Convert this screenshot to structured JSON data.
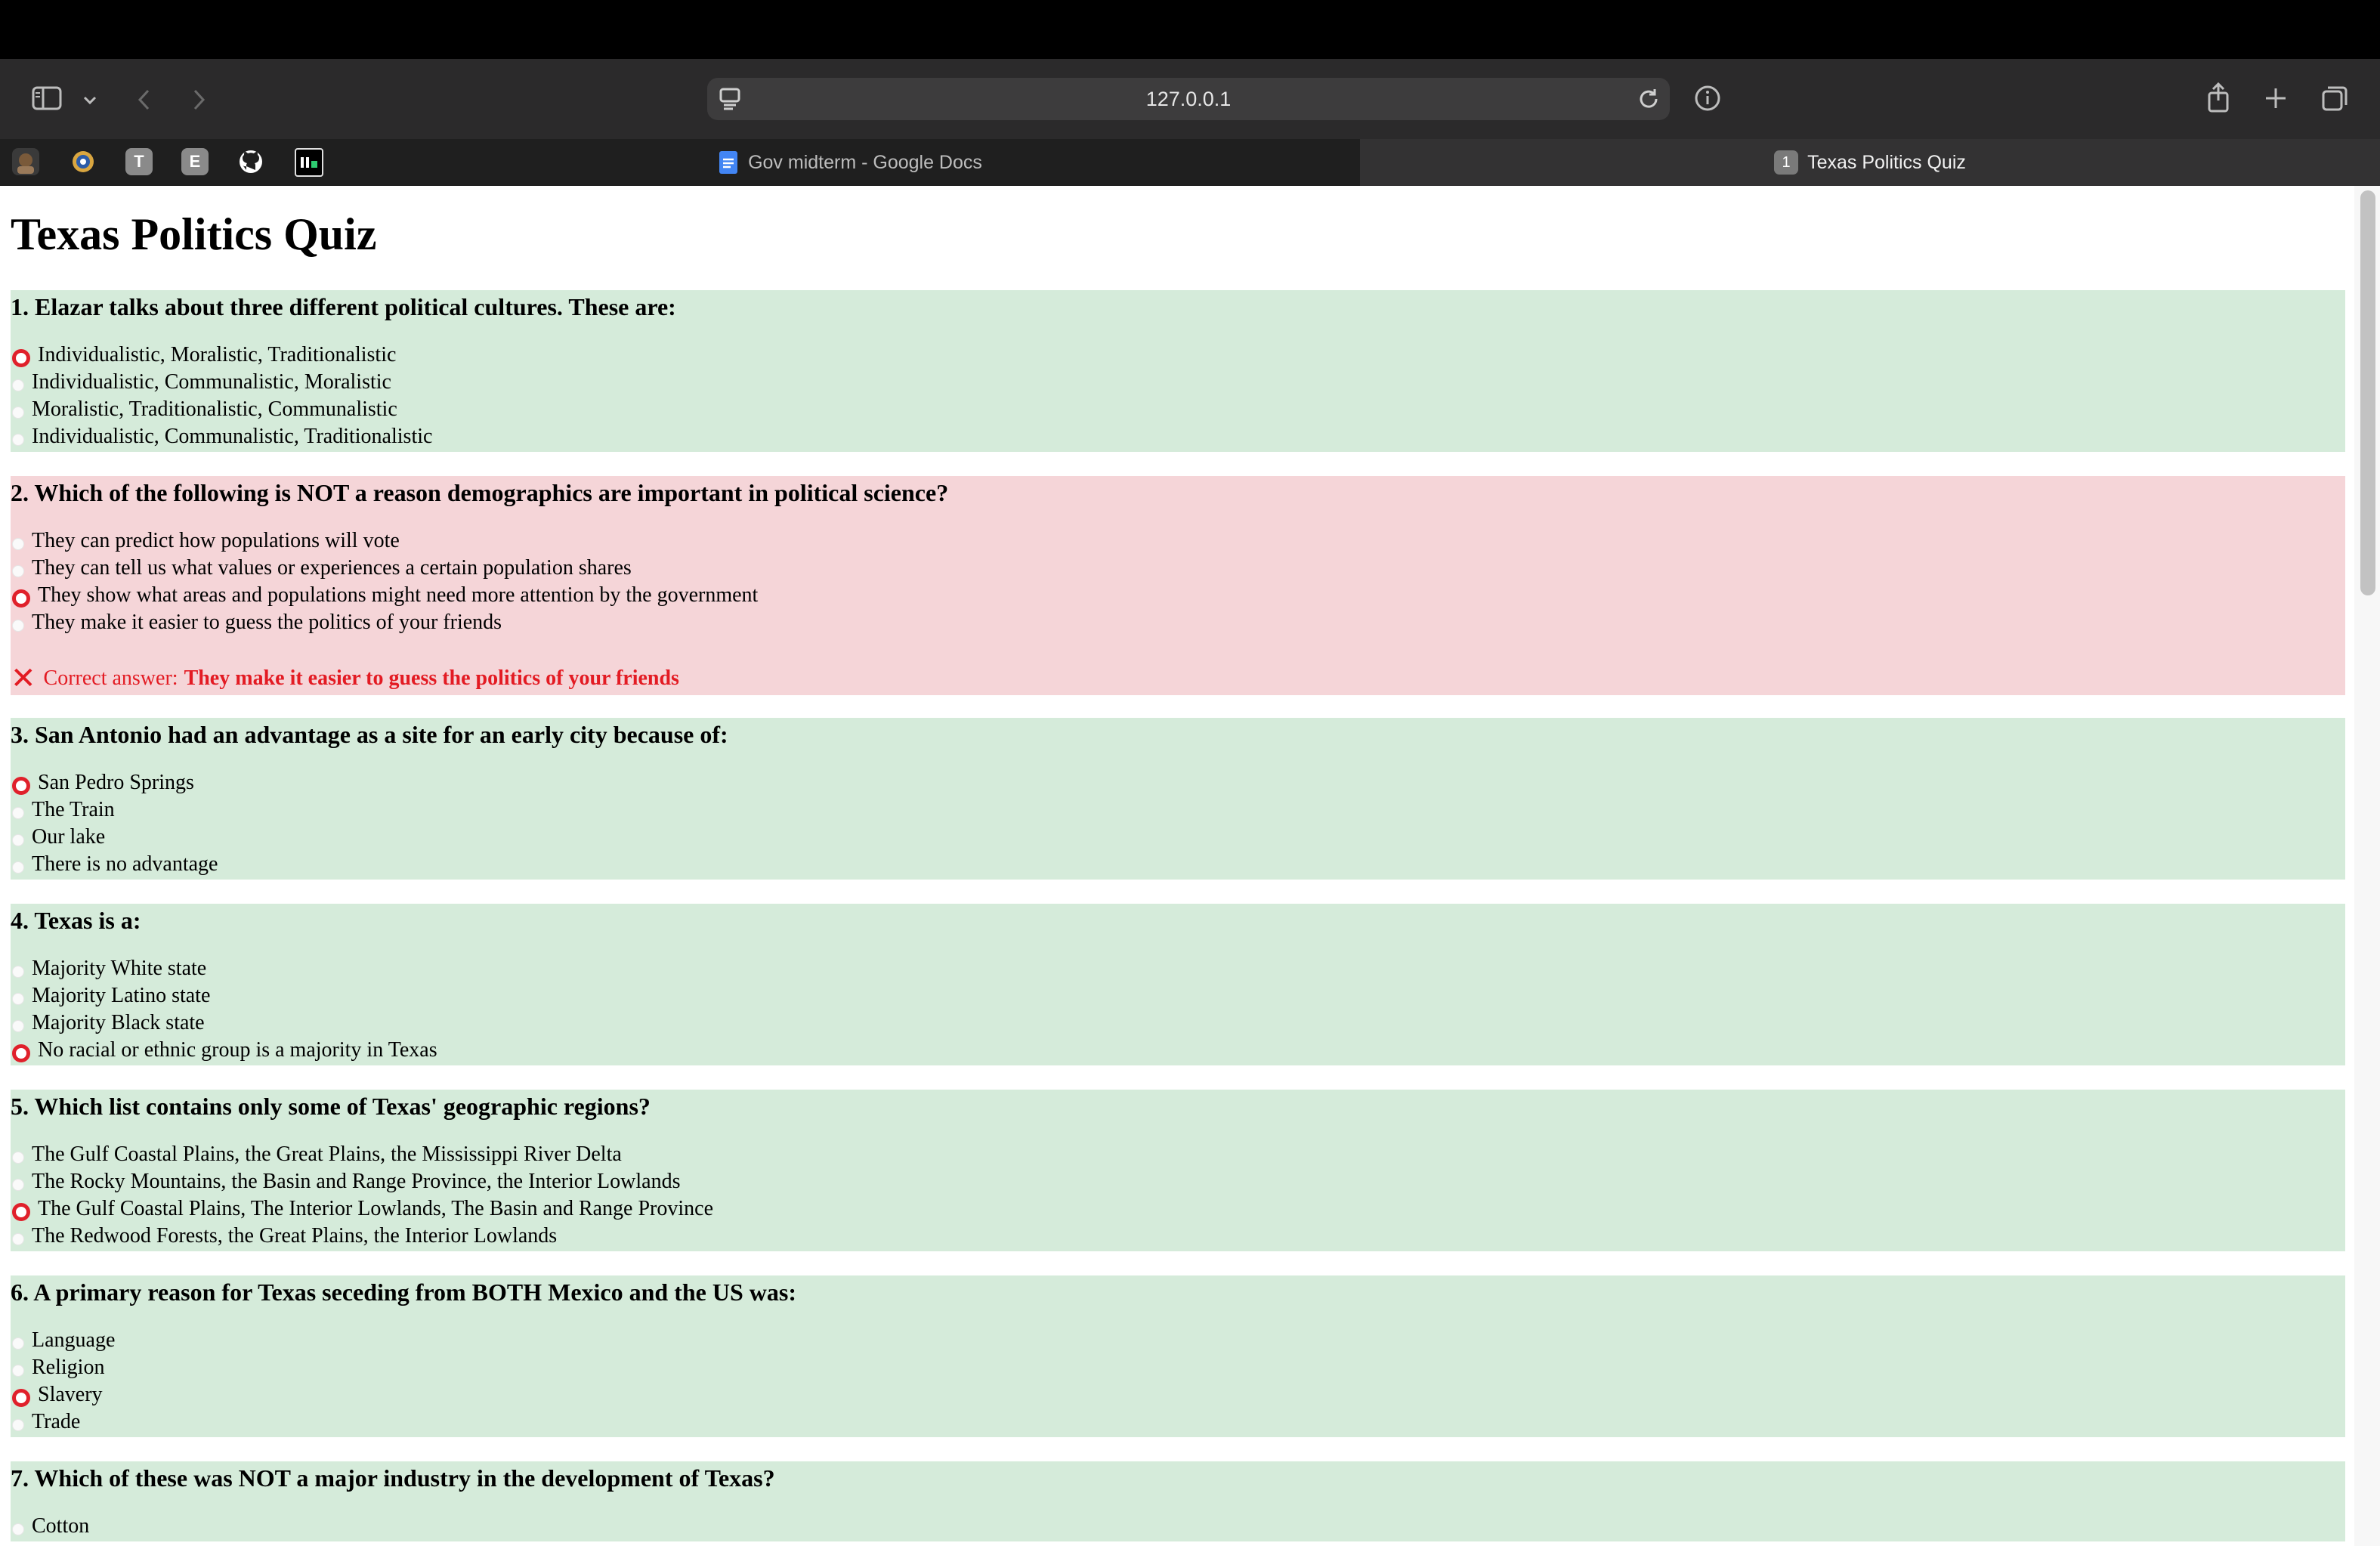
{
  "browser": {
    "url": "127.0.0.1",
    "tabs": [
      {
        "label": "Gov midterm - Google Docs",
        "active": false
      },
      {
        "label": "Texas Politics Quiz",
        "active": true,
        "badge": "1"
      }
    ],
    "favorites": [
      {
        "icon": "avatar-icon"
      },
      {
        "icon": "gear-flower-icon"
      },
      {
        "icon": "letter-icon",
        "letter": "T"
      },
      {
        "icon": "letter-icon",
        "letter": "E"
      },
      {
        "icon": "github-icon"
      },
      {
        "icon": "terminal-icon"
      }
    ],
    "colors": {
      "toolbar": "#2b2a2b",
      "tabstrip": "#1f1f1f",
      "active_tab": "#333233"
    }
  },
  "quiz": {
    "title": "Texas Politics Quiz",
    "colors": {
      "correct_bg": "#d5ebda",
      "wrong_bg": "#f5d5d8",
      "selected_radio": "#e0212b",
      "feedback_text": "#e31b23"
    },
    "questions": [
      {
        "text": "1. Elazar talks about three different political cultures. These are:",
        "status": "correct",
        "options": [
          "Individualistic, Moralistic, Traditionalistic",
          "Individualistic, Communalistic, Moralistic",
          "Moralistic, Traditionalistic, Communalistic",
          "Individualistic, Communalistic, Traditionalistic"
        ],
        "selected": 0
      },
      {
        "text": "2. Which of the following is NOT a reason demographics are important in political science?",
        "status": "wrong",
        "options": [
          "They can predict how populations will vote",
          "They can tell us what values or experiences a certain population shares",
          "They show what areas and populations might need more attention by the government",
          "They make it easier to guess the politics of your friends"
        ],
        "selected": 2,
        "feedback_prefix": "Correct answer:",
        "feedback_answer": "They make it easier to guess the politics of your friends"
      },
      {
        "text": "3. San Antonio had an advantage as a site for an early city because of:",
        "status": "correct",
        "options": [
          "San Pedro Springs",
          "The Train",
          "Our lake",
          "There is no advantage"
        ],
        "selected": 0
      },
      {
        "text": "4. Texas is a:",
        "status": "correct",
        "options": [
          "Majority White state",
          "Majority Latino state",
          "Majority Black state",
          "No racial or ethnic group is a majority in Texas"
        ],
        "selected": 3
      },
      {
        "text": "5. Which list contains only some of Texas' geographic regions?",
        "status": "correct",
        "options": [
          "The Gulf Coastal Plains, the Great Plains, the Mississippi River Delta",
          "The Rocky Mountains, the Basin and Range Province, the Interior Lowlands",
          "The Gulf Coastal Plains, The Interior Lowlands, The Basin and Range Province",
          "The Redwood Forests, the Great Plains, the Interior Lowlands"
        ],
        "selected": 2
      },
      {
        "text": "6. A primary reason for Texas seceding from BOTH Mexico and the US was:",
        "status": "correct",
        "options": [
          "Language",
          "Religion",
          "Slavery",
          "Trade"
        ],
        "selected": 2
      },
      {
        "text": "7. Which of these was NOT a major industry in the development of Texas?",
        "status": "correct",
        "options": [
          "Cotton"
        ],
        "selected": -1
      }
    ]
  }
}
